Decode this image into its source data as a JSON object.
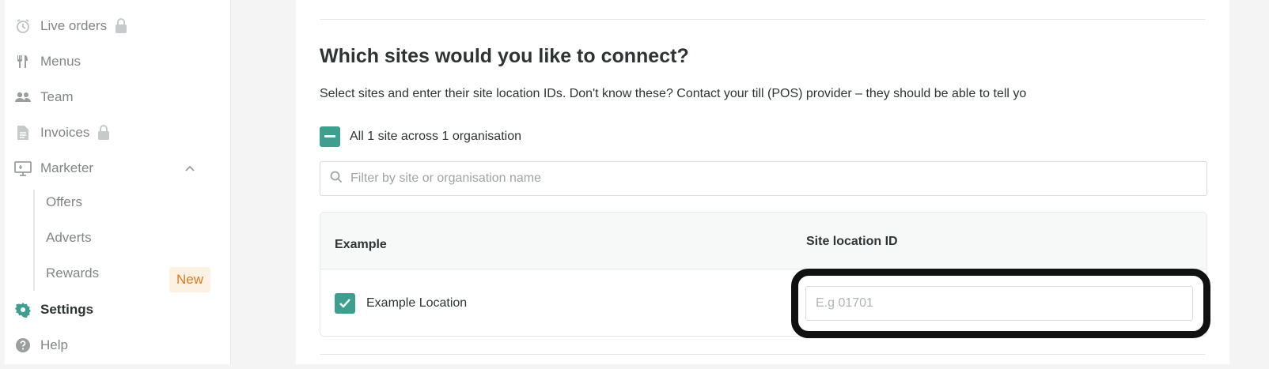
{
  "sidebar": {
    "items": [
      {
        "label": "Live orders",
        "icon": "clock-icon",
        "locked": true
      },
      {
        "label": "Menus",
        "icon": "cutlery-icon",
        "locked": false
      },
      {
        "label": "Team",
        "icon": "people-icon",
        "locked": false
      },
      {
        "label": "Invoices",
        "icon": "document-icon",
        "locked": true
      },
      {
        "label": "Marketer",
        "icon": "monitor-icon",
        "expanded": true
      }
    ],
    "subitems": [
      {
        "label": "Offers"
      },
      {
        "label": "Adverts"
      },
      {
        "label": "Rewards",
        "badge": "New"
      }
    ],
    "settings_label": "Settings",
    "help_label": "Help"
  },
  "main": {
    "heading": "Which sites would you like to connect?",
    "subtext": "Select sites and enter their site location IDs. Don't know these? Contact your till (POS) provider – they should be able to tell yo",
    "select_all_label": "All 1 site across 1 organisation",
    "filter_placeholder": "Filter by site or organisation name",
    "table": {
      "col_example": "Example",
      "col_site": "Site location ID",
      "rows": [
        {
          "name": "Example Location",
          "checked": true,
          "site_id_placeholder": "E.g 01701"
        }
      ]
    }
  },
  "colors": {
    "accent": "#3e9f8f",
    "badge_text": "#e07a1f",
    "badge_bg": "#fdf1e4",
    "highlight_border": "#111111"
  }
}
